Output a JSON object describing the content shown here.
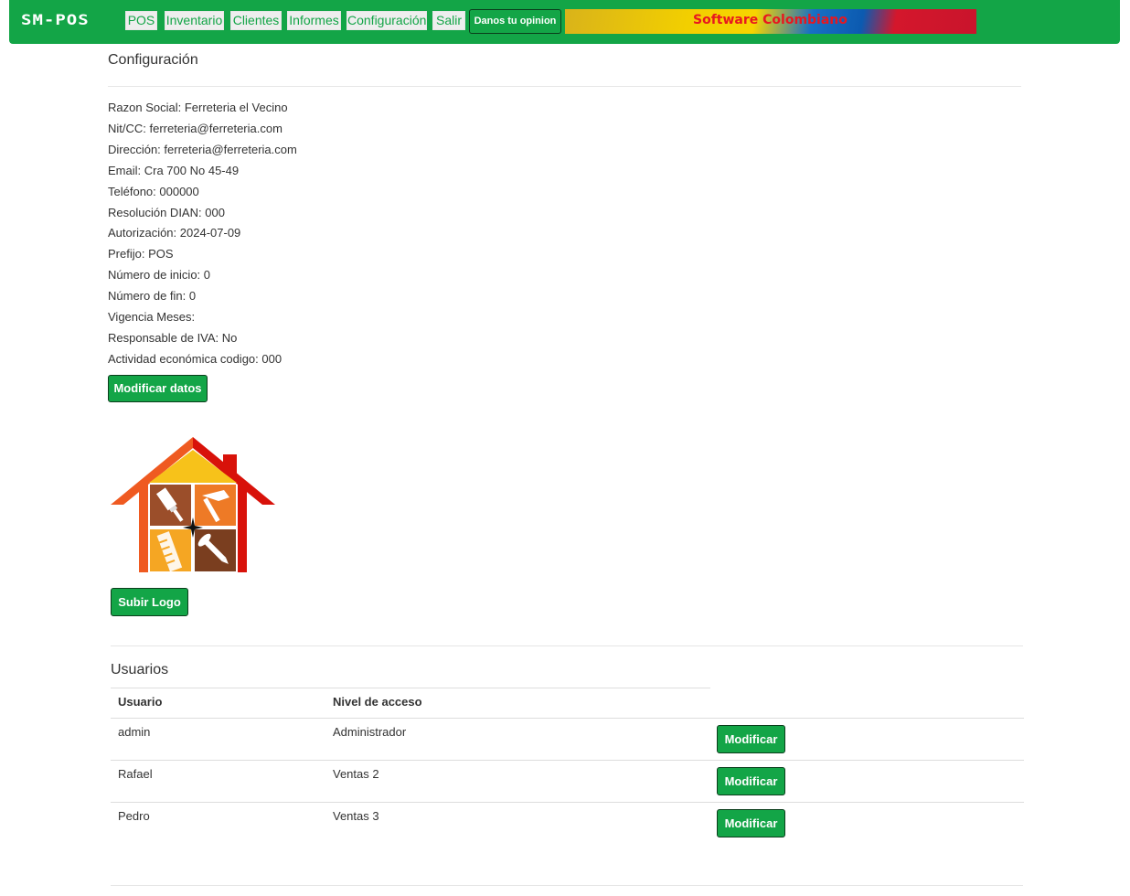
{
  "nav": {
    "brand": "SM-POS",
    "items": [
      "POS",
      "Inventario",
      "Clientes",
      "Informes",
      "Configuración",
      "Salir"
    ],
    "opinion_label": "Danos tu opinion",
    "banner_text": "Software Colombiano",
    "color": "#13a547"
  },
  "page": {
    "title": "Configuración",
    "info": [
      {
        "label": "Razon Social:",
        "value": "Ferreteria el Vecino"
      },
      {
        "label": "Nit/CC:",
        "value": "ferreteria@ferreteria.com"
      },
      {
        "label": "Dirección:",
        "value": "ferreteria@ferreteria.com"
      },
      {
        "label": "Email:",
        "value": "Cra 700 No 45-49"
      },
      {
        "label": "Teléfono:",
        "value": "000000"
      },
      {
        "label": "Resolución DIAN:",
        "value": "000"
      },
      {
        "label": "Autorización:",
        "value": "2024-07-09"
      },
      {
        "label": "Prefijo:",
        "value": "POS"
      },
      {
        "label": "Número de inicio:",
        "value": "0"
      },
      {
        "label": "Número de fin:",
        "value": "0"
      },
      {
        "label": "Vigencia Meses:",
        "value": ""
      },
      {
        "label": "Responsable de IVA:",
        "value": "No"
      },
      {
        "label": "Actividad económica codigo:",
        "value": "000"
      }
    ],
    "modify_label": "Modificar datos",
    "upload_logo_label": "Subir Logo"
  },
  "users": {
    "title": "Usuarios",
    "headers": [
      "Usuario",
      "Nivel de acceso"
    ],
    "rows": [
      {
        "user": "admin",
        "level": "Administrador",
        "action": "Modificar"
      },
      {
        "user": "Rafael",
        "level": "Ventas 2",
        "action": "Modificar"
      },
      {
        "user": "Pedro",
        "level": "Ventas 3",
        "action": "Modificar"
      }
    ]
  }
}
